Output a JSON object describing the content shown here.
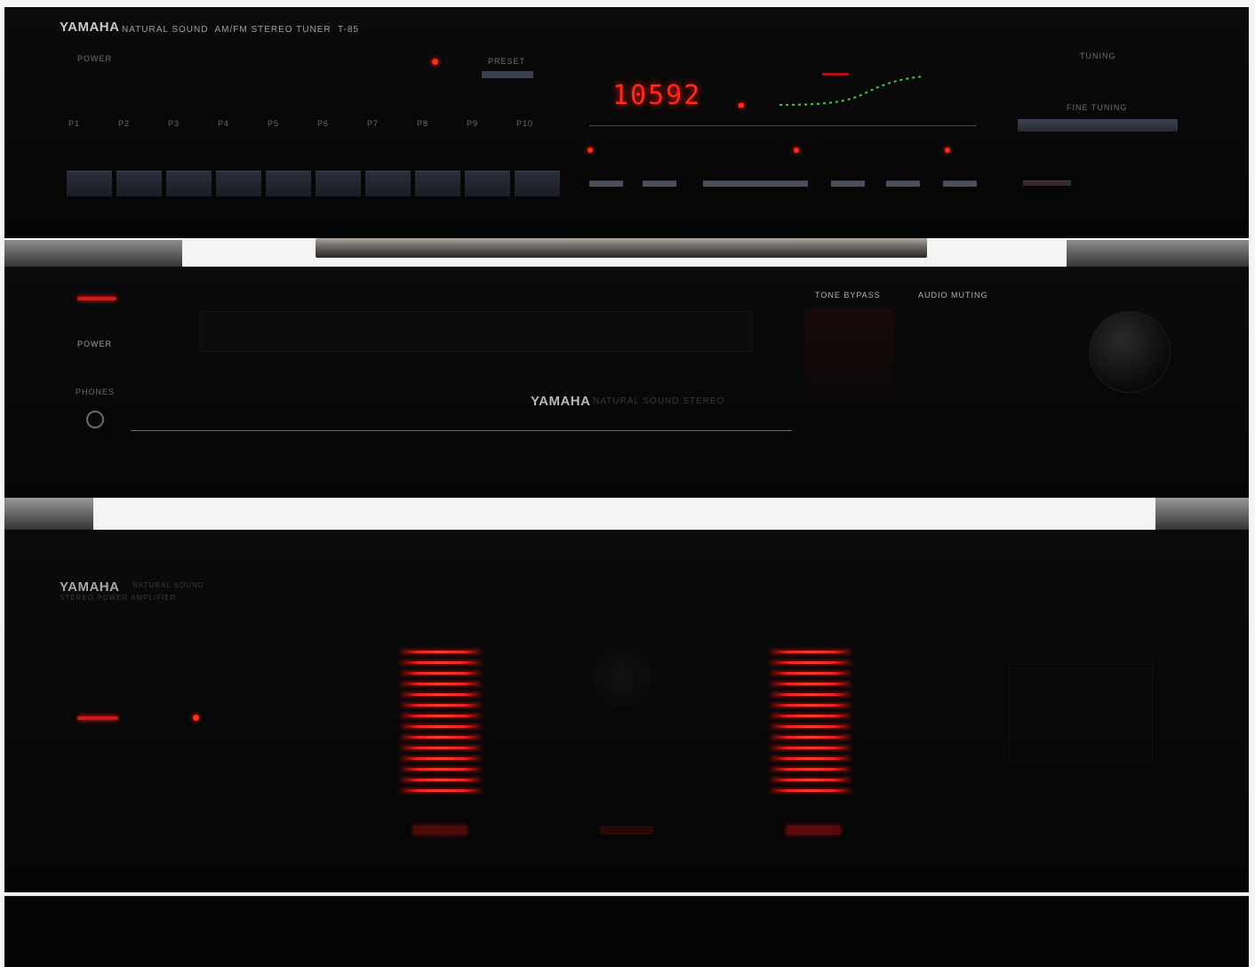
{
  "tuner": {
    "brand": "YAMAHA",
    "model_line": "NATURAL SOUND  AM/FM STEREO TUNER  T-85",
    "power_label": "POWER",
    "preset_label": "PRESET",
    "frequency": "10592",
    "fine_tuning_label": "FINE TUNING",
    "tuning_label": "TUNING",
    "preset_keys": [
      "P1",
      "P2",
      "P3",
      "P4",
      "P5",
      "P6",
      "P7",
      "P8",
      "P9",
      "P10"
    ]
  },
  "amplifier": {
    "brand": "YAMAHA",
    "power_label": "POWER",
    "phones_label": "PHONES",
    "tone_bypass_label": "TONE BYPASS",
    "audio_muting_label": "AUDIO MUTING",
    "control_amp_text": "NATURAL SOUND STEREO"
  },
  "power_amp": {
    "brand": "YAMAHA",
    "line1": "NATURAL SOUND",
    "line2": "STEREO POWER AMPLIFIER"
  },
  "colors": {
    "led_red": "#ff2a1a",
    "chassis": "#080808",
    "background": "#f4f4f2"
  }
}
